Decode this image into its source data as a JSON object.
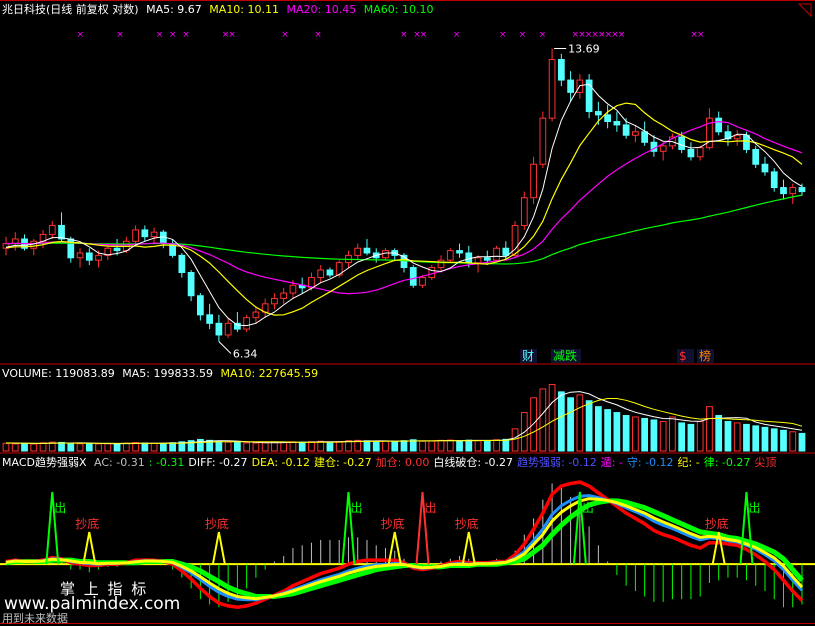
{
  "colors": {
    "bg": "#000000",
    "up": "#ff3030",
    "down": "#54ffff",
    "ma5": "#ffffff",
    "ma10": "#ffff00",
    "ma20": "#ff00ff",
    "ma60": "#00ff00",
    "border": "#c00000",
    "macd_green": "#00ff00",
    "macd_red": "#ff0000",
    "macd_yellow": "#ffff00",
    "macd_blue": "#1f8fff"
  },
  "price_panel": {
    "stock_name": "兆日科技(日线 前复权 对数)",
    "ma5_label": "MA5: 9.67",
    "ma10_label": "MA10: 10.11",
    "ma20_label": "MA20: 10.45",
    "ma60_label": "MA60: 10.10",
    "high_label": "13.69",
    "low_label": "6.34",
    "tags": [
      {
        "text": "财",
        "color": "#54ffff"
      },
      {
        "text": "减跌",
        "color": "#00ff00"
      },
      {
        "text": "$",
        "color": "#ff3030"
      },
      {
        "text": "榜",
        "color": "#ff8000"
      }
    ]
  },
  "volume_panel": {
    "volume_label": "VOLUME: 119083.89",
    "ma5_label": "MA5: 199833.59",
    "ma10_label": "MA10: 227645.59"
  },
  "macd_panel": {
    "name_label": "MACD趋势强弱X",
    "items": [
      {
        "text": "AC: -0.31",
        "color": "#c0c0c0"
      },
      {
        "text": ": -0.31",
        "color": "#00ff00"
      },
      {
        "text": "DIFF: -0.27",
        "color": "#ffffff"
      },
      {
        "text": "DEA: -0.12",
        "color": "#ffff00"
      },
      {
        "text": "建仓: -0.27",
        "color": "#ffff00"
      },
      {
        "text": "加仓: 0.00",
        "color": "#ff3030"
      },
      {
        "text": "白线破仓: -0.27",
        "color": "#ffffff"
      },
      {
        "text": "趋势强弱: -0.12",
        "color": "#5050ff"
      },
      {
        "text": "遁: -",
        "color": "#ff00ff"
      },
      {
        "text": "守: -0.12",
        "color": "#1f8fff"
      },
      {
        "text": "纪: -",
        "color": "#ffff00"
      },
      {
        "text": "律: -0.27",
        "color": "#00ff00"
      },
      {
        "text": "尖顶",
        "color": "#ff3030"
      }
    ],
    "signals_out": [
      "出",
      "出",
      "出",
      "出",
      "出",
      "出"
    ],
    "signals_bottom": [
      "抄底",
      "抄底",
      "抄底",
      "抄底",
      "抄底"
    ]
  },
  "watermark": {
    "line1": "掌 上 指 标",
    "line2": "www.palmindex.com",
    "line3": "用到未来数据"
  },
  "chart_data": [
    {
      "type": "candlestick",
      "title": "兆日科技(日线 前复权 对数)",
      "scale": "log",
      "ylim": [
        6.2,
        14.6
      ],
      "annotated_high": 13.69,
      "annotated_low": 6.34,
      "ohlc": [
        [
          8.1,
          8.35,
          7.95,
          8.2
        ],
        [
          8.2,
          8.45,
          8.05,
          8.3
        ],
        [
          8.3,
          8.4,
          8.05,
          8.1
        ],
        [
          8.1,
          8.3,
          7.95,
          8.25
        ],
        [
          8.25,
          8.5,
          8.1,
          8.4
        ],
        [
          8.4,
          8.7,
          8.3,
          8.6
        ],
        [
          8.6,
          8.9,
          8.2,
          8.3
        ],
        [
          8.3,
          8.35,
          7.8,
          7.9
        ],
        [
          7.9,
          8.1,
          7.7,
          8.0
        ],
        [
          8.0,
          8.1,
          7.75,
          7.85
        ],
        [
          7.85,
          8.05,
          7.7,
          7.95
        ],
        [
          7.95,
          8.2,
          7.85,
          8.1
        ],
        [
          8.1,
          8.3,
          7.95,
          8.05
        ],
        [
          8.05,
          8.35,
          8.0,
          8.25
        ],
        [
          8.25,
          8.6,
          8.15,
          8.5
        ],
        [
          8.5,
          8.6,
          8.25,
          8.35
        ],
        [
          8.35,
          8.55,
          8.2,
          8.45
        ],
        [
          8.45,
          8.5,
          8.1,
          8.2
        ],
        [
          8.2,
          8.3,
          7.9,
          7.95
        ],
        [
          7.95,
          8.0,
          7.5,
          7.6
        ],
        [
          7.6,
          7.65,
          7.05,
          7.15
        ],
        [
          7.15,
          7.2,
          6.7,
          6.8
        ],
        [
          6.8,
          7.0,
          6.55,
          6.65
        ],
        [
          6.65,
          6.8,
          6.34,
          6.45
        ],
        [
          6.45,
          6.75,
          6.4,
          6.65
        ],
        [
          6.65,
          6.85,
          6.5,
          6.55
        ],
        [
          6.55,
          6.8,
          6.5,
          6.75
        ],
        [
          6.75,
          6.95,
          6.65,
          6.85
        ],
        [
          6.85,
          7.1,
          6.75,
          7.0
        ],
        [
          7.0,
          7.2,
          6.9,
          7.1
        ],
        [
          7.1,
          7.3,
          7.0,
          7.2
        ],
        [
          7.2,
          7.45,
          7.1,
          7.35
        ],
        [
          7.35,
          7.5,
          7.2,
          7.3
        ],
        [
          7.3,
          7.6,
          7.25,
          7.5
        ],
        [
          7.5,
          7.75,
          7.4,
          7.65
        ],
        [
          7.65,
          7.7,
          7.5,
          7.55
        ],
        [
          7.55,
          7.85,
          7.5,
          7.8
        ],
        [
          7.8,
          8.05,
          7.7,
          7.95
        ],
        [
          7.95,
          8.2,
          7.85,
          8.1
        ],
        [
          8.1,
          8.3,
          7.95,
          8.0
        ],
        [
          8.0,
          8.1,
          7.8,
          7.9
        ],
        [
          7.9,
          8.1,
          7.85,
          8.05
        ],
        [
          8.05,
          8.1,
          7.85,
          7.95
        ],
        [
          7.95,
          8.0,
          7.6,
          7.7
        ],
        [
          7.7,
          7.75,
          7.3,
          7.35
        ],
        [
          7.35,
          7.55,
          7.3,
          7.5
        ],
        [
          7.5,
          7.75,
          7.45,
          7.7
        ],
        [
          7.7,
          7.95,
          7.6,
          7.85
        ],
        [
          7.85,
          8.1,
          7.8,
          8.05
        ],
        [
          8.05,
          8.2,
          7.9,
          8.0
        ],
        [
          8.0,
          8.15,
          7.7,
          7.8
        ],
        [
          7.8,
          7.95,
          7.6,
          7.9
        ],
        [
          7.9,
          8.05,
          7.75,
          7.85
        ],
        [
          7.85,
          8.15,
          7.8,
          8.1
        ],
        [
          8.1,
          8.25,
          7.85,
          7.95
        ],
        [
          7.95,
          8.7,
          7.9,
          8.6
        ],
        [
          8.6,
          9.4,
          8.5,
          9.25
        ],
        [
          9.25,
          10.3,
          9.1,
          10.1
        ],
        [
          10.1,
          11.6,
          10.0,
          11.4
        ],
        [
          11.4,
          13.69,
          11.3,
          13.3
        ],
        [
          13.3,
          13.5,
          12.4,
          12.6
        ],
        [
          12.6,
          12.9,
          11.9,
          12.2
        ],
        [
          12.2,
          12.8,
          12.0,
          12.6
        ],
        [
          12.6,
          12.8,
          11.4,
          11.6
        ],
        [
          11.6,
          11.9,
          11.2,
          11.5
        ],
        [
          11.5,
          11.8,
          11.1,
          11.3
        ],
        [
          11.3,
          11.6,
          11.0,
          11.2
        ],
        [
          11.2,
          11.4,
          10.8,
          10.9
        ],
        [
          10.9,
          11.2,
          10.7,
          11.0
        ],
        [
          11.0,
          11.3,
          10.6,
          10.7
        ],
        [
          10.7,
          10.9,
          10.3,
          10.45
        ],
        [
          10.45,
          10.7,
          10.2,
          10.6
        ],
        [
          10.6,
          10.95,
          10.5,
          10.85
        ],
        [
          10.85,
          11.0,
          10.4,
          10.5
        ],
        [
          10.5,
          10.7,
          10.2,
          10.3
        ],
        [
          10.3,
          10.6,
          10.2,
          10.55
        ],
        [
          10.55,
          11.7,
          10.5,
          11.4
        ],
        [
          11.4,
          11.6,
          10.9,
          11.0
        ],
        [
          11.0,
          11.2,
          10.6,
          10.8
        ],
        [
          10.8,
          11.05,
          10.6,
          10.9
        ],
        [
          10.9,
          11.0,
          10.4,
          10.5
        ],
        [
          10.5,
          10.6,
          10.0,
          10.1
        ],
        [
          10.1,
          10.3,
          9.8,
          9.9
        ],
        [
          9.9,
          10.0,
          9.4,
          9.5
        ],
        [
          9.5,
          9.7,
          9.2,
          9.35
        ],
        [
          9.35,
          9.6,
          9.1,
          9.5
        ],
        [
          9.5,
          9.6,
          9.3,
          9.4
        ]
      ],
      "ma5_last": 9.67,
      "ma10_last": 10.11,
      "ma20_last": 10.45,
      "ma60_last": 10.1
    },
    {
      "type": "bar",
      "title": "VOLUME",
      "values": [
        52000,
        48000,
        50000,
        47000,
        55000,
        60000,
        58000,
        52000,
        49000,
        51000,
        48000,
        50000,
        47000,
        53000,
        57000,
        54000,
        52000,
        50000,
        56000,
        62000,
        70000,
        78000,
        72000,
        68000,
        60000,
        57000,
        55000,
        54000,
        56000,
        58000,
        60000,
        62000,
        59000,
        63000,
        66000,
        61000,
        64000,
        70000,
        72000,
        69000,
        65000,
        67000,
        63000,
        70000,
        76000,
        66000,
        68000,
        72000,
        74000,
        70000,
        73000,
        69000,
        71000,
        76000,
        79000,
        150000,
        260000,
        360000,
        420000,
        450000,
        400000,
        360000,
        380000,
        340000,
        300000,
        280000,
        260000,
        240000,
        230000,
        220000,
        210000,
        200000,
        230000,
        190000,
        180000,
        200000,
        300000,
        240000,
        200000,
        190000,
        180000,
        170000,
        160000,
        150000,
        140000,
        130000,
        119083.89
      ],
      "ma5_last": 199833.59,
      "ma10_last": 227645.59
    },
    {
      "type": "line",
      "title": "MACD趋势强弱X",
      "series": [
        {
          "name": "DIFF",
          "values": [
            0.02,
            0.03,
            0.02,
            0.02,
            0.03,
            0.05,
            0.04,
            0.01,
            0.0,
            -0.01,
            -0.01,
            0.0,
            0.0,
            0.01,
            0.03,
            0.03,
            0.03,
            0.02,
            0.0,
            -0.05,
            -0.11,
            -0.18,
            -0.24,
            -0.29,
            -0.31,
            -0.32,
            -0.31,
            -0.29,
            -0.26,
            -0.23,
            -0.2,
            -0.16,
            -0.13,
            -0.1,
            -0.07,
            -0.05,
            -0.03,
            0.0,
            0.02,
            0.03,
            0.03,
            0.03,
            0.03,
            0.01,
            -0.03,
            -0.04,
            -0.03,
            -0.01,
            0.01,
            0.02,
            0.01,
            0.01,
            0.01,
            0.02,
            0.02,
            0.07,
            0.15,
            0.26,
            0.38,
            0.52,
            0.58,
            0.6,
            0.61,
            0.58,
            0.53,
            0.48,
            0.43,
            0.38,
            0.34,
            0.3,
            0.25,
            0.22,
            0.2,
            0.17,
            0.14,
            0.12,
            0.16,
            0.16,
            0.15,
            0.14,
            0.11,
            0.07,
            0.02,
            -0.04,
            -0.12,
            -0.2,
            -0.27
          ]
        },
        {
          "name": "DEA",
          "values": [
            0.01,
            0.02,
            0.02,
            0.02,
            0.02,
            0.03,
            0.03,
            0.03,
            0.02,
            0.02,
            0.01,
            0.01,
            0.01,
            0.01,
            0.01,
            0.02,
            0.02,
            0.02,
            0.02,
            0.0,
            -0.02,
            -0.05,
            -0.09,
            -0.13,
            -0.17,
            -0.2,
            -0.22,
            -0.24,
            -0.24,
            -0.24,
            -0.23,
            -0.22,
            -0.2,
            -0.18,
            -0.16,
            -0.14,
            -0.12,
            -0.1,
            -0.08,
            -0.06,
            -0.04,
            -0.03,
            -0.02,
            -0.01,
            -0.01,
            -0.02,
            -0.02,
            -0.02,
            -0.01,
            -0.01,
            -0.01,
            0.0,
            0.0,
            0.0,
            0.01,
            0.02,
            0.04,
            0.09,
            0.14,
            0.22,
            0.29,
            0.35,
            0.4,
            0.44,
            0.46,
            0.47,
            0.47,
            0.46,
            0.44,
            0.42,
            0.39,
            0.36,
            0.33,
            0.3,
            0.27,
            0.24,
            0.23,
            0.22,
            0.2,
            0.19,
            0.17,
            0.15,
            0.12,
            0.09,
            0.04,
            -0.04,
            -0.12
          ]
        }
      ],
      "ylim": [
        -0.4,
        0.7
      ]
    }
  ]
}
